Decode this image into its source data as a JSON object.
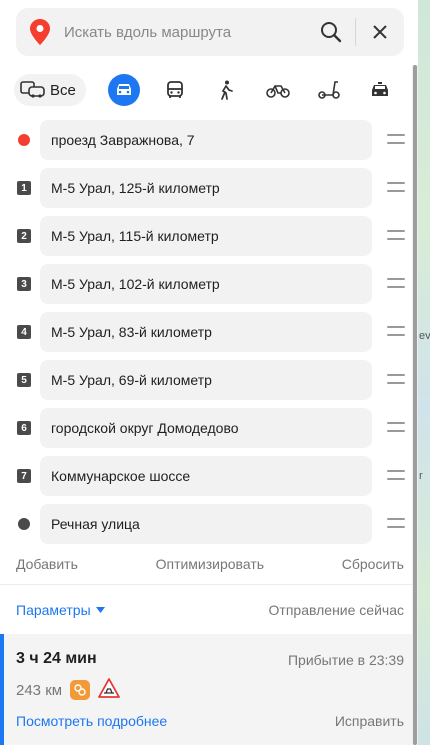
{
  "colors": {
    "accent": "#1e77f2",
    "start_marker": "#f43f30",
    "end_marker": "#4a4a4a",
    "toll_badge": "#f39a38"
  },
  "search": {
    "placeholder": "Искать вдоль маршрута"
  },
  "modes": [
    {
      "id": "all",
      "label": "Все",
      "icon": "car-transit-icon",
      "active": false
    },
    {
      "id": "car",
      "icon": "car-icon",
      "active": true
    },
    {
      "id": "transit",
      "icon": "bus-icon",
      "active": false
    },
    {
      "id": "walk",
      "icon": "pedestrian-icon",
      "active": false
    },
    {
      "id": "bike",
      "icon": "bicycle-icon",
      "active": false
    },
    {
      "id": "scooter",
      "icon": "scooter-icon",
      "active": false
    },
    {
      "id": "taxi",
      "icon": "taxi-icon",
      "active": false
    }
  ],
  "waypoints": [
    {
      "marker": "",
      "type": "start",
      "label": "проезд Завражнова, 7"
    },
    {
      "marker": "1",
      "type": "via",
      "label": "М-5 Урал, 125-й километр"
    },
    {
      "marker": "2",
      "type": "via",
      "label": "М-5 Урал, 115-й километр"
    },
    {
      "marker": "3",
      "type": "via",
      "label": "М-5 Урал, 102-й километр"
    },
    {
      "marker": "4",
      "type": "via",
      "label": "М-5 Урал, 83-й километр"
    },
    {
      "marker": "5",
      "type": "via",
      "label": "М-5 Урал, 69-й километр"
    },
    {
      "marker": "6",
      "type": "via",
      "label": "городской округ Домодедово"
    },
    {
      "marker": "7",
      "type": "via",
      "label": "Коммунарское шоссе"
    },
    {
      "marker": "",
      "type": "end",
      "label": "Речная улица"
    }
  ],
  "actions": {
    "add": "Добавить",
    "optimize": "Оптимизировать",
    "reset": "Сбросить"
  },
  "params": {
    "label": "Параметры",
    "departure": "Отправление сейчас"
  },
  "route": {
    "duration": "3 ч 24 мин",
    "arrival": "Прибытие в 23:39",
    "distance": "243 км",
    "details_link": "Посмотреть подробнее",
    "fix_link": "Исправить"
  },
  "map_edge": {
    "label_1": "ev",
    "label_2": "r"
  }
}
